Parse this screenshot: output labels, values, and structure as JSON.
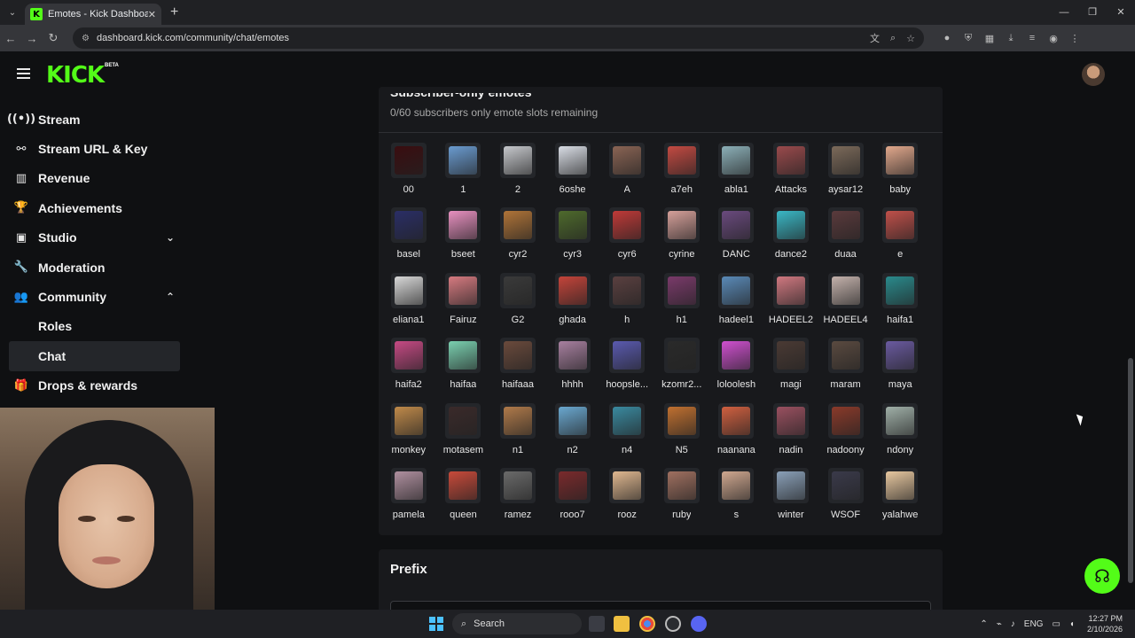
{
  "browser": {
    "tab_title": "Emotes - Kick Dashboard",
    "tab_favicon": "K",
    "url": "dashboard.kick.com/community/chat/emotes"
  },
  "header": {
    "logo": "KICK",
    "beta": "BETA"
  },
  "sidebar": {
    "items": [
      {
        "label": "Stream",
        "icon": "broadcast-icon",
        "glyph": "((•))"
      },
      {
        "label": "Stream URL & Key",
        "icon": "link-icon",
        "glyph": "⚯"
      },
      {
        "label": "Revenue",
        "icon": "chart-icon",
        "glyph": "▥"
      },
      {
        "label": "Achievements",
        "icon": "trophy-icon",
        "glyph": "🏆"
      },
      {
        "label": "Studio",
        "icon": "studio-icon",
        "glyph": "▣"
      },
      {
        "label": "Moderation",
        "icon": "wrench-icon",
        "glyph": "🔧"
      },
      {
        "label": "Community",
        "icon": "people-icon",
        "glyph": "👥"
      }
    ],
    "community_sub": [
      "Roles",
      "Chat"
    ],
    "drops": {
      "label": "Drops & rewards",
      "icon": "gift-icon",
      "glyph": "🎁"
    }
  },
  "emotes": {
    "title": "Subscriber-only emotes",
    "subtitle": "0/60 subscribers only emote slots remaining",
    "items": [
      {
        "name": "00",
        "color": "#3a0d10"
      },
      {
        "name": "1",
        "color": "#6a9bd0"
      },
      {
        "name": "2",
        "color": "#c6c8cc"
      },
      {
        "name": "6oshe",
        "color": "#d9dde5"
      },
      {
        "name": "A",
        "color": "#8a6454"
      },
      {
        "name": "a7eh",
        "color": "#c34a42"
      },
      {
        "name": "abla1",
        "color": "#8cb0b8"
      },
      {
        "name": "Attacks",
        "color": "#9a4a4c"
      },
      {
        "name": "aysar12",
        "color": "#7c6a5a"
      },
      {
        "name": "baby",
        "color": "#e2a88c"
      },
      {
        "name": "basel",
        "color": "#2a2e66"
      },
      {
        "name": "bseet",
        "color": "#e890c0"
      },
      {
        "name": "cyr2",
        "color": "#b07438"
      },
      {
        "name": "cyr3",
        "color": "#4e6a2c"
      },
      {
        "name": "cyr6",
        "color": "#c03a38"
      },
      {
        "name": "cyrine",
        "color": "#d6a09a"
      },
      {
        "name": "DANC",
        "color": "#6a4a7e"
      },
      {
        "name": "dance2",
        "color": "#3ab8c6"
      },
      {
        "name": "duaa",
        "color": "#5a3a3c"
      },
      {
        "name": "e",
        "color": "#c0504a"
      },
      {
        "name": "eliana1",
        "color": "#d8d8d8"
      },
      {
        "name": "Fairuz",
        "color": "#d67a80"
      },
      {
        "name": "G2",
        "color": "#3a3a3a"
      },
      {
        "name": "ghada",
        "color": "#c4443a"
      },
      {
        "name": "h",
        "color": "#5a4040"
      },
      {
        "name": "h1",
        "color": "#7a3a6a"
      },
      {
        "name": "hadeel1",
        "color": "#5a8ab8"
      },
      {
        "name": "HADEEL2",
        "color": "#d07880"
      },
      {
        "name": "HADEEL4",
        "color": "#c4b2ac"
      },
      {
        "name": "haifa1",
        "color": "#2a8a8c"
      },
      {
        "name": "haifa2",
        "color": "#c64a84"
      },
      {
        "name": "haifaa",
        "color": "#7ad0b0"
      },
      {
        "name": "haifaaa",
        "color": "#6a4a3c"
      },
      {
        "name": "hhhh",
        "color": "#a880a0"
      },
      {
        "name": "hoopsle...",
        "color": "#5a5ab0"
      },
      {
        "name": "kzomr2...",
        "color": "#2a2a2a"
      },
      {
        "name": "loloolesh",
        "color": "#d050d0"
      },
      {
        "name": "magi",
        "color": "#4a3a34"
      },
      {
        "name": "maram",
        "color": "#5a4a40"
      },
      {
        "name": "maya",
        "color": "#6a5aa0"
      },
      {
        "name": "monkey",
        "color": "#c08a4a"
      },
      {
        "name": "motasem",
        "color": "#3a2a2a"
      },
      {
        "name": "n1",
        "color": "#b07a4a"
      },
      {
        "name": "n2",
        "color": "#6aa8d0"
      },
      {
        "name": "n4",
        "color": "#3a8aa0"
      },
      {
        "name": "N5",
        "color": "#c07030"
      },
      {
        "name": "naanana",
        "color": "#d06040"
      },
      {
        "name": "nadin",
        "color": "#9a5060"
      },
      {
        "name": "nadoony",
        "color": "#8a3a2a"
      },
      {
        "name": "ndony",
        "color": "#a0b0a8"
      },
      {
        "name": "pamela",
        "color": "#b090a0"
      },
      {
        "name": "queen",
        "color": "#c84a3a"
      },
      {
        "name": "ramez",
        "color": "#6a6a6a"
      },
      {
        "name": "rooo7",
        "color": "#7a2a2c"
      },
      {
        "name": "rooz",
        "color": "#e0b890"
      },
      {
        "name": "ruby",
        "color": "#a07060"
      },
      {
        "name": "s",
        "color": "#d0a890"
      },
      {
        "name": "winter",
        "color": "#8aa0b8"
      },
      {
        "name": "WSOF",
        "color": "#3a3a4a"
      },
      {
        "name": "yalahwe",
        "color": "#e8c8a0"
      }
    ]
  },
  "prefix": {
    "title": "Prefix"
  },
  "taskbar": {
    "search": "Search",
    "lang": "ENG",
    "time": "12:27 PM",
    "date": "2/10/2026"
  },
  "colors": {
    "brand": "#53fc18",
    "background": "#0f1012",
    "card": "#18191c"
  }
}
